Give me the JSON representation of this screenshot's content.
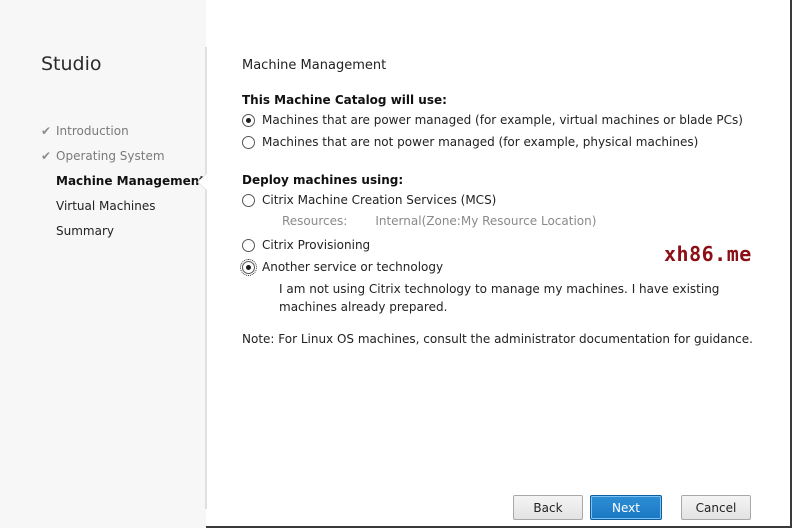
{
  "sidebar": {
    "app_title": "Studio",
    "steps": [
      {
        "label": "Introduction",
        "state": "done"
      },
      {
        "label": "Operating System",
        "state": "done"
      },
      {
        "label": "Machine Management",
        "state": "current"
      },
      {
        "label": "Virtual Machines",
        "state": "pending"
      },
      {
        "label": "Summary",
        "state": "pending"
      }
    ]
  },
  "main": {
    "section_title": "Machine Management",
    "catalog_group": {
      "label": "This Machine Catalog will use:",
      "options": [
        {
          "label": "Machines that are power managed (for example, virtual machines or blade PCs)",
          "checked": true
        },
        {
          "label": "Machines that are not power managed (for example, physical machines)",
          "checked": false
        }
      ]
    },
    "deploy_group": {
      "label": "Deploy machines using:",
      "mcs_label": "Citrix Machine Creation Services (MCS)",
      "resources_label": "Resources:",
      "resources_value": "Internal(Zone:My Resource Location)",
      "provisioning_label": "Citrix Provisioning",
      "another_label": "Another service or technology",
      "another_desc": "I am not using Citrix technology to manage my machines. I have existing machines already prepared.",
      "selected": "another"
    },
    "note": "Note: For Linux OS machines, consult the administrator documentation for guidance."
  },
  "watermark": "xh86.me",
  "buttons": {
    "back": "Back",
    "next": "Next",
    "cancel": "Cancel"
  },
  "colors": {
    "accent": "#1a78c2",
    "watermark": "#8b0f14"
  }
}
